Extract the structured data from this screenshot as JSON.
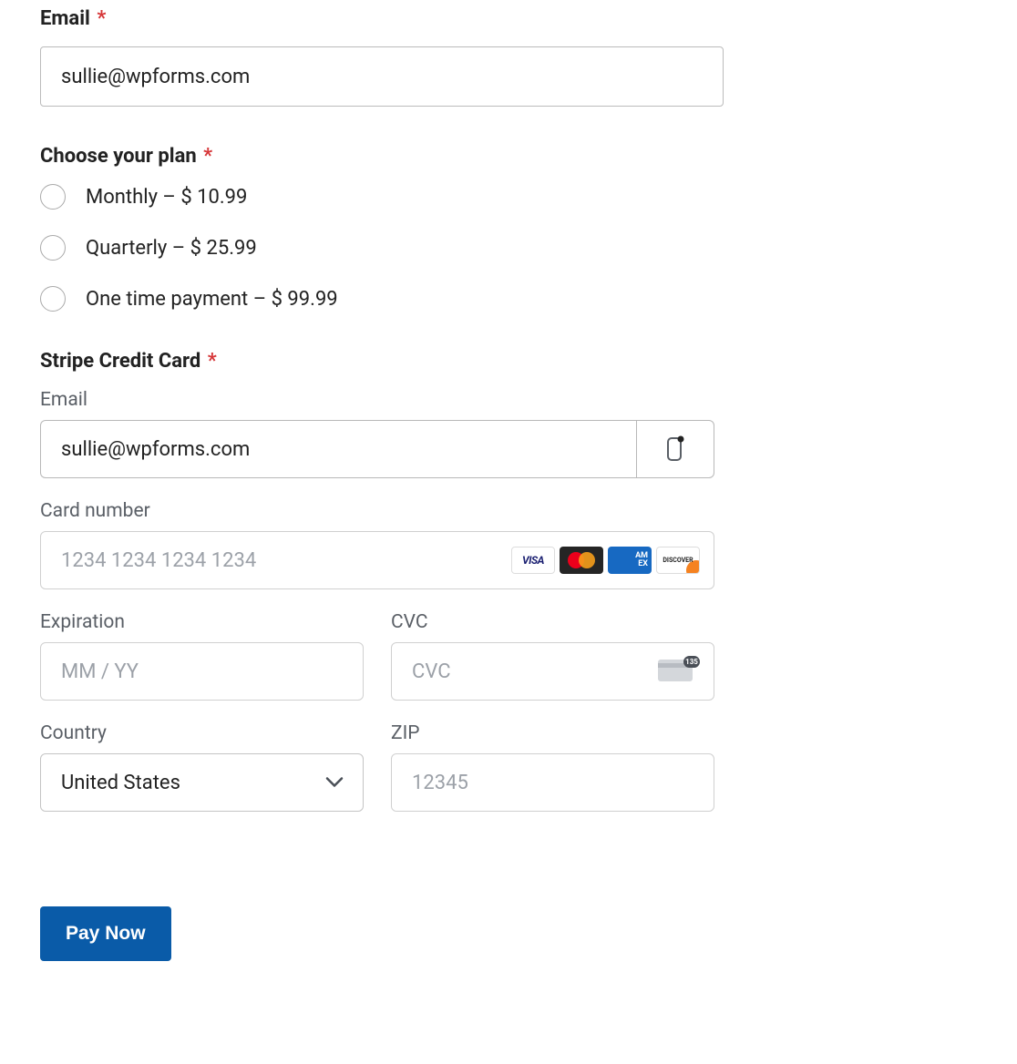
{
  "email": {
    "label": "Email",
    "value": "sullie@wpforms.com"
  },
  "plan": {
    "label": "Choose your plan",
    "options": [
      "Monthly – $ 10.99",
      "Quarterly – $ 25.99",
      "One time payment – $ 99.99"
    ]
  },
  "stripe": {
    "label": "Stripe Credit Card",
    "email_label": "Email",
    "email_value": "sullie@wpforms.com",
    "card_label": "Card number",
    "card_placeholder": "1234 1234 1234 1234",
    "expiration_label": "Expiration",
    "expiration_placeholder": "MM / YY",
    "cvc_label": "CVC",
    "cvc_placeholder": "CVC",
    "country_label": "Country",
    "country_value": "United States",
    "zip_label": "ZIP",
    "zip_placeholder": "12345",
    "brands": {
      "visa": "VISA",
      "amex": "AM\nEX",
      "discover": "DISCOVER"
    }
  },
  "submit": {
    "label": "Pay Now"
  }
}
